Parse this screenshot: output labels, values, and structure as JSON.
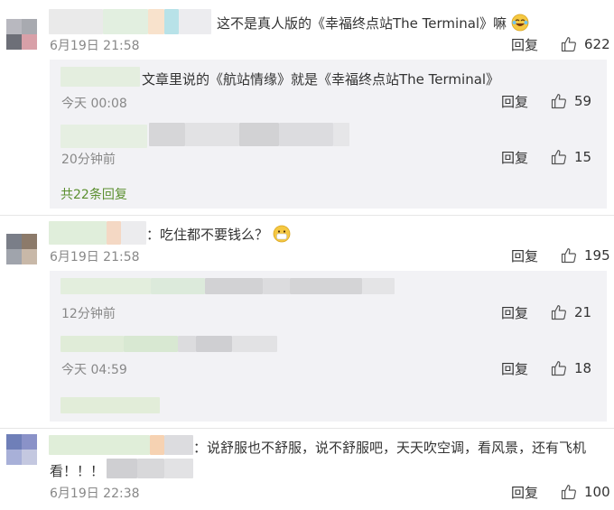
{
  "comments": [
    {
      "text": "这不是真人版的《幸福终点站The Terminal》嘛",
      "emoji": "laughing-tears-emoji",
      "time": "6月19日 21:58",
      "reply_label": "回复",
      "likes": "622",
      "replies": [
        {
          "text": "文章里说的《航站情缘》就是《幸福终点站The Terminal》",
          "time": "今天 00:08",
          "reply_label": "回复",
          "likes": "59"
        },
        {
          "text": "",
          "time": "20分钟前",
          "reply_label": "回复",
          "likes": "15"
        }
      ],
      "more_replies": "共22条回复"
    },
    {
      "text": "：吃住都不要钱么？",
      "emoji": "mask-face-emoji",
      "time": "6月19日 21:58",
      "reply_label": "回复",
      "likes": "195",
      "replies": [
        {
          "text": "",
          "time": "12分钟前",
          "reply_label": "回复",
          "likes": "21"
        },
        {
          "text": "",
          "time": "今天 04:59",
          "reply_label": "回复",
          "likes": "18"
        }
      ]
    },
    {
      "text": "：说舒服也不舒服，说不舒服吧，天天吹空调，看风景，还有飞机",
      "text_line2": "看！！！",
      "time": "6月19日 22:38",
      "reply_label": "回复",
      "likes": "100"
    }
  ],
  "colors": {
    "accent_green": "#5b8f2f",
    "subbox_bg": "#f2f2f5",
    "timestamp": "#888888"
  }
}
